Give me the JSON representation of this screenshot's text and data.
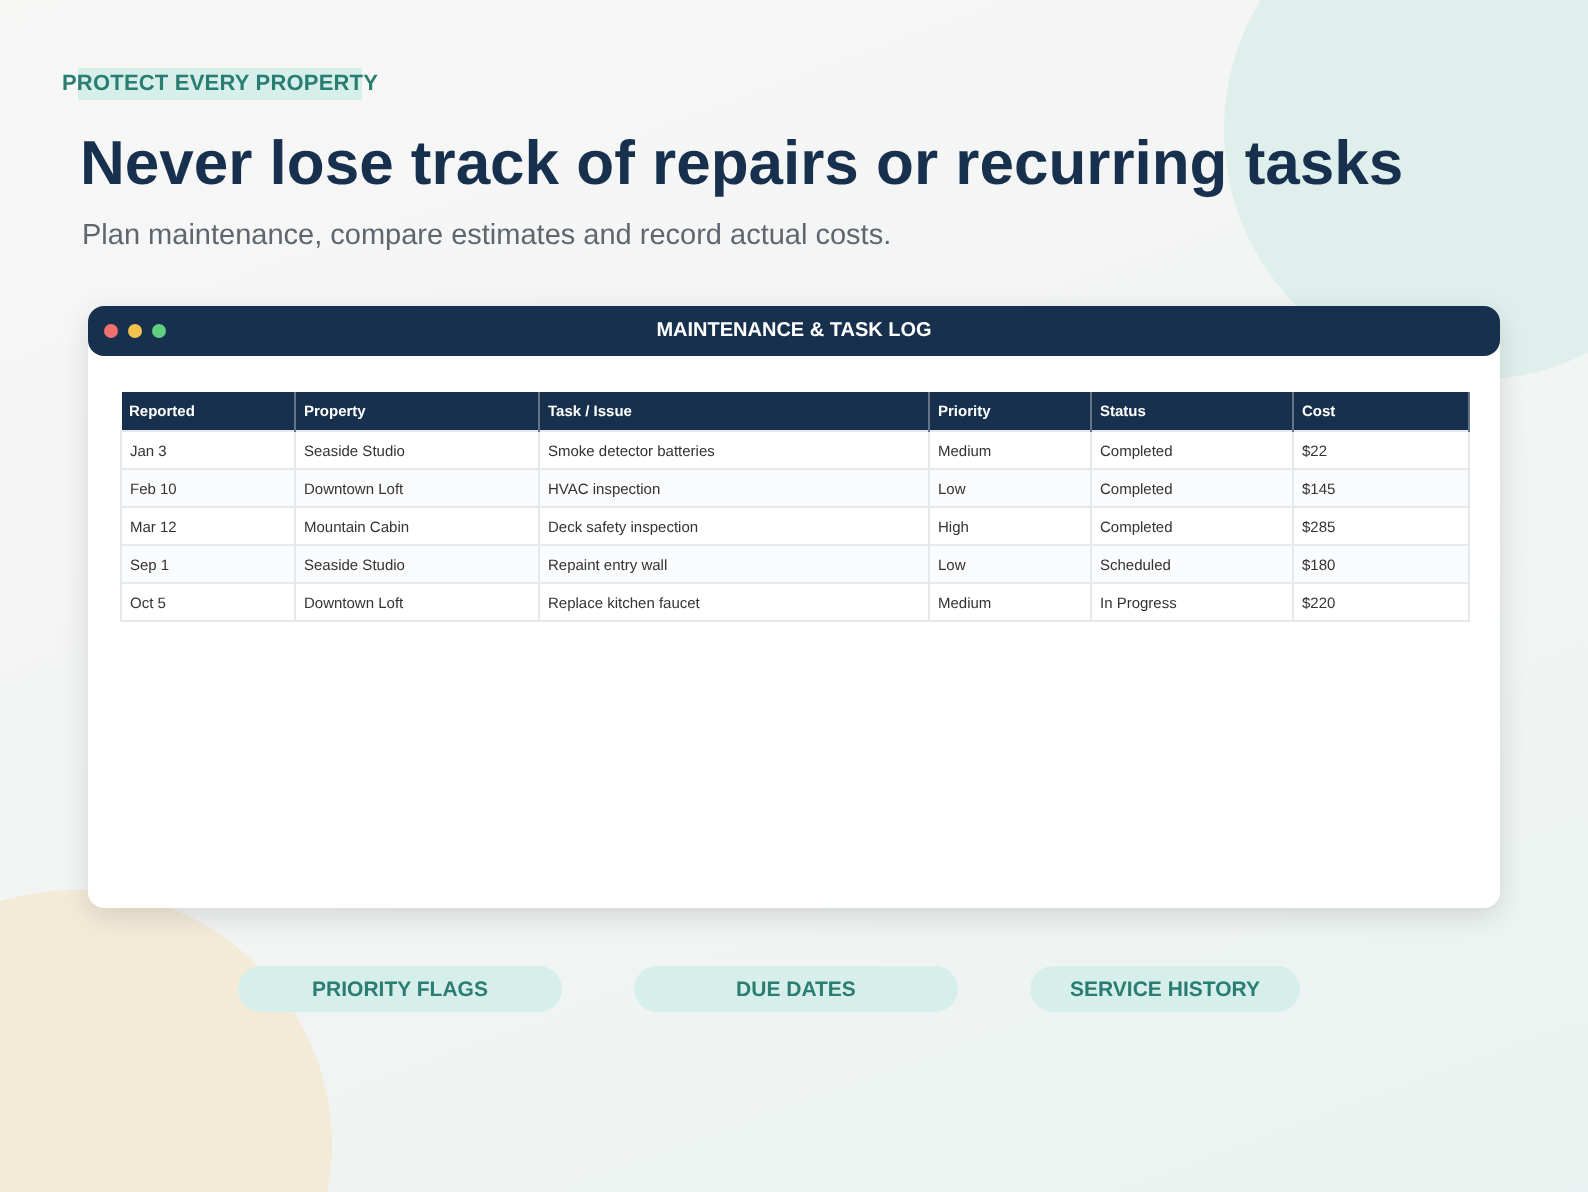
{
  "eyebrow": "PROTECT EVERY PROPERTY",
  "headline": "Never lose track of repairs or recurring tasks",
  "subtitle": "Plan maintenance, compare estimates and record actual costs.",
  "window": {
    "title": "MAINTENANCE & TASK LOG"
  },
  "table": {
    "columns": [
      "Reported",
      "Property",
      "Task / Issue",
      "Priority",
      "Status",
      "Cost"
    ],
    "rows": [
      [
        "Jan 3",
        "Seaside Studio",
        "Smoke detector batteries",
        "Medium",
        "Completed",
        "$22"
      ],
      [
        "Feb 10",
        "Downtown Loft",
        "HVAC inspection",
        "Low",
        "Completed",
        "$145"
      ],
      [
        "Mar 12",
        "Mountain Cabin",
        "Deck safety inspection",
        "High",
        "Completed",
        "$285"
      ],
      [
        "Sep 1",
        "Seaside Studio",
        "Repaint entry wall",
        "Low",
        "Scheduled",
        "$180"
      ],
      [
        "Oct 5",
        "Downtown Loft",
        "Replace kitchen faucet",
        "Medium",
        "In Progress",
        "$220"
      ]
    ]
  },
  "features": [
    "PRIORITY FLAGS",
    "DUE DATES",
    "SERVICE HISTORY"
  ]
}
